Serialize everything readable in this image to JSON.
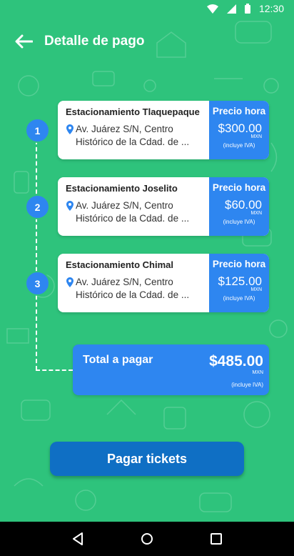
{
  "status_bar": {
    "time": "12:30"
  },
  "header": {
    "title": "Detalle de pago"
  },
  "steps": [
    {
      "number": "1",
      "name": "Estacionamiento Tlaquepaque",
      "address_line1": "Av. Juárez S/N, Centro",
      "address_line2": "Histórico de la Cdad. de ...",
      "price_label": "Precio hora",
      "price": "$300.00",
      "currency": "MXN",
      "tax_note": "(incluye IVA)"
    },
    {
      "number": "2",
      "name": "Estacionamiento Joselito",
      "address_line1": "Av. Juárez S/N, Centro",
      "address_line2": "Histórico de la Cdad. de ...",
      "price_label": "Precio hora",
      "price": "$60.00",
      "currency": "MXN",
      "tax_note": "(incluye IVA)"
    },
    {
      "number": "3",
      "name": "Estacionamiento Chimal",
      "address_line1": "Av. Juárez S/N, Centro",
      "address_line2": "Histórico de la Cdad. de ...",
      "price_label": "Precio hora",
      "price": "$125.00",
      "currency": "MXN",
      "tax_note": "(incluye IVA)"
    }
  ],
  "total": {
    "label": "Total a pagar",
    "amount": "$485.00",
    "currency": "MXN",
    "tax_note": "(incluye IVA)"
  },
  "pay_button": {
    "label": "Pagar tickets"
  },
  "colors": {
    "background": "#2ec37c",
    "accent": "#2e86f0",
    "button": "#0f6fc4"
  },
  "icons": {
    "back": "arrow-left-icon",
    "pin": "location-pin-icon",
    "nav": [
      "back-triangle-icon",
      "home-circle-icon",
      "recents-square-icon"
    ]
  }
}
